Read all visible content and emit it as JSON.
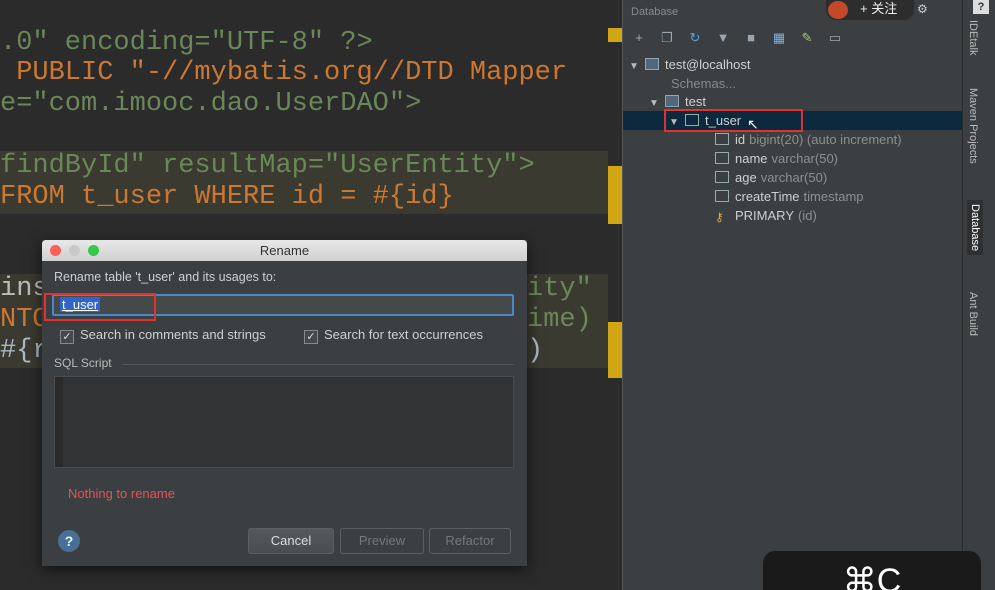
{
  "editor": {
    "lines": [
      {
        "text": ".0\" encoding=\"UTF-8\" ?>"
      },
      {
        "text": " PUBLIC \"-//mybatis.org//DTD Mapper"
      },
      {
        "text": "e=\"com.imooc.dao.UserDAO\">"
      },
      {
        "text": "findById\" resultMap=\"UserEntity\">"
      },
      {
        "text": "FROM t_user WHERE id = #{id}"
      },
      {
        "text": "ins"
      },
      {
        "text": "NTO"
      },
      {
        "text": "#{r"
      }
    ],
    "partial_right": {
      "line6": "ity\"",
      "line7": "ime)",
      "line8": ")"
    }
  },
  "database_panel": {
    "title": "Database",
    "toolbar_icons": [
      "add-icon",
      "copy-icon",
      "refresh-icon",
      "filter-icon",
      "stop-icon",
      "table-icon",
      "edit-icon",
      "console-icon"
    ],
    "tree": {
      "datasource": "test@localhost",
      "schemas": "Schemas...",
      "schema": "test",
      "table": "t_user",
      "columns": [
        {
          "name": "id",
          "type": "bigint(20) (auto increment)"
        },
        {
          "name": "name",
          "type": "varchar(50)"
        },
        {
          "name": "age",
          "type": "varchar(50)"
        },
        {
          "name": "createTime",
          "type": "timestamp"
        }
      ],
      "key": {
        "name": "PRIMARY",
        "detail": "(id)"
      }
    }
  },
  "right_tabs": [
    "IDEtalk",
    "Maven Projects",
    "Database",
    "Ant Build"
  ],
  "overlay": {
    "follow_label": "+ 关注",
    "help": "?",
    "shortcut": "⌘C"
  },
  "dialog": {
    "title": "Rename",
    "label": "Rename table 't_user' and its usages to:",
    "input_value": "t_user",
    "check_comments": "Search in comments and strings",
    "check_text": "Search for text occurrences",
    "sql_label": "SQL Script",
    "error": "Nothing to rename",
    "help": "?",
    "buttons": {
      "cancel": "Cancel",
      "preview": "Preview",
      "refactor": "Refactor"
    }
  },
  "colors": {
    "highlight": "#e0322e",
    "selection": "#2f65ca",
    "error": "#e05555"
  }
}
